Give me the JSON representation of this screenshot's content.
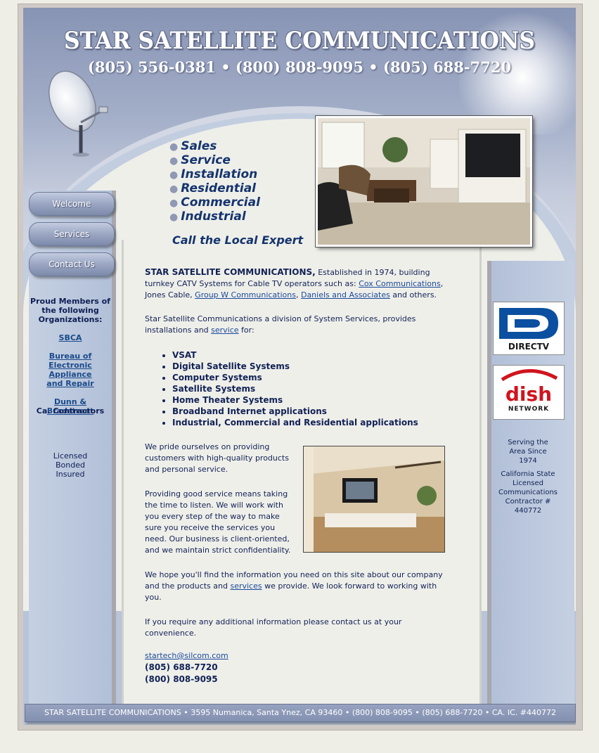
{
  "header": {
    "title": "STAR SATELLITE COMMUNICATIONS",
    "phones": "(805) 556-0381 • (800) 808-9095 • (805) 688-7720"
  },
  "nav": [
    {
      "label": "Welcome"
    },
    {
      "label": "Services"
    },
    {
      "label": "Contact Us"
    }
  ],
  "left": {
    "members_heading": "Proud Members of the following Organizations:",
    "org1": "SBCA",
    "org2": "Bureau of Electronic Appliance and Repair",
    "org3": "Dunn & Bradstreet",
    "org3_sub": "Ca. Contractors",
    "licensed": "Licensed",
    "bonded": "Bonded",
    "insured": "Insured"
  },
  "services_list": [
    "Sales",
    "Service",
    "Installation",
    "Residential",
    "Commercial",
    "Industrial"
  ],
  "tagline": "Call the Local Expert",
  "intro": {
    "company": "STAR SATELLITE COMMUNICATIONS,",
    "text1": " Established in 1974, building turnkey CATV Systems for Cable TV operators such as: ",
    "link_cox": "Cox Communications",
    "text2": ", Jones Cable, ",
    "link_groupw": "Group W Communications",
    "text3": ", ",
    "link_daniels": "Daniels and Associates",
    "text4": " and others."
  },
  "division": {
    "text1": "Star Satellite Communications a division of System Services, provides installations and ",
    "link_service": "service",
    "text2": " for:"
  },
  "offerings": [
    "VSAT",
    "Digital Satellite Systems",
    "Computer Systems",
    "Satellite Systems",
    "Home Theater Systems",
    "Broadband Internet applications",
    "Industrial, Commercial and Residential applications"
  ],
  "para_pride": "We pride ourselves on providing customers with high-quality products and personal service.",
  "para_listen": "Providing good service means taking the time to listen. We will work with you every step of the way to make sure you receive the services you need. Our business is client-oriented, and we maintain strict confidentiality.",
  "para_hope": {
    "text1": "We hope you'll find the information you need on this site about our company and the products and ",
    "link_services": "services",
    "text2": " we provide. We look forward to working with you."
  },
  "para_contact": "If you require any additional information please contact us at your convenience.",
  "contact": {
    "email": "startech@silcom.com",
    "phone1": "(805) 688-7720",
    "phone2": "(800) 808-9095"
  },
  "right": {
    "directv_logo": "DIRECTV",
    "dish_logo": "dish NETWORK",
    "serving": "Serving the Area Since 1974",
    "license": "California State Licensed Communications Contractor # 440772"
  },
  "footer": "STAR SATELLITE COMMUNICATIONS • 3595 Numanica, Santa Ynez, CA 93460 • (800) 808-9095 • (805) 688-7720 • CA. IC. #440772",
  "colors": {
    "brand_navy": "#14346e",
    "link_blue": "#1a4a9a",
    "directv_blue": "#0b4fa0",
    "dish_red": "#d0141e"
  }
}
